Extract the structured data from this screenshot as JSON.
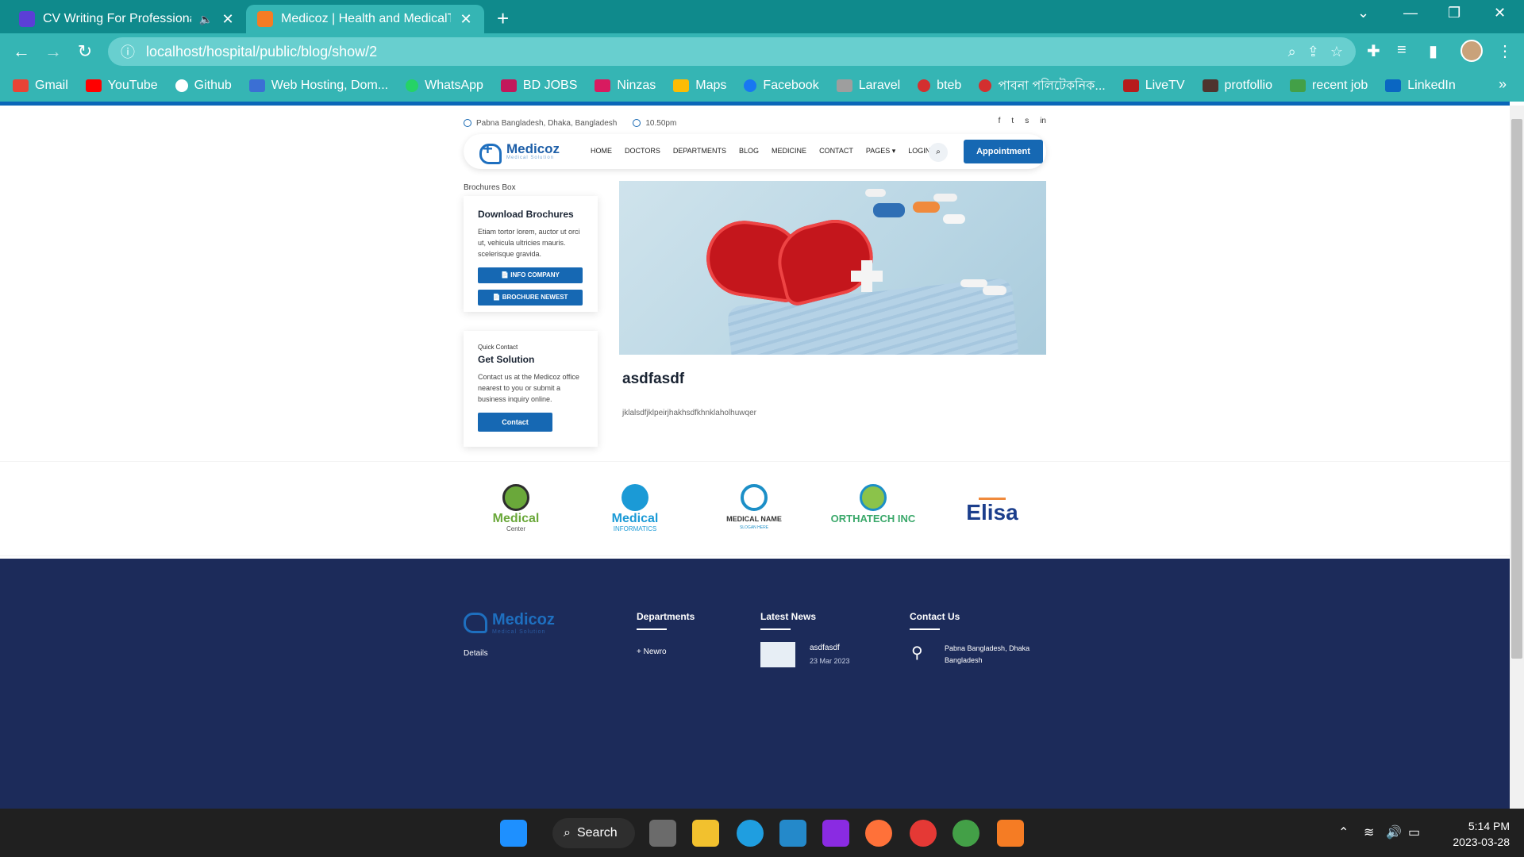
{
  "browser": {
    "tabs": [
      {
        "title": "CV Writing For Professionals",
        "active": false
      },
      {
        "title": "Medicoz | Health and MedicalTem",
        "active": true
      }
    ],
    "url": "localhost/hospital/public/blog/show/2",
    "bookmarks": [
      "Gmail",
      "YouTube",
      "Github",
      "Web Hosting, Dom...",
      "WhatsApp",
      "BD JOBS",
      "Ninzas",
      "Maps",
      "Facebook",
      "Laravel",
      "bteb",
      "পাবনা পলিটেকনিক...",
      "LiveTV",
      "protfollio",
      "recent job",
      "LinkedIn"
    ]
  },
  "site": {
    "address": "Pabna Bangladesh, Dhaka, Bangladesh",
    "time": "10.50pm",
    "logo_name": "Medicoz",
    "logo_sub": "Medical Solution",
    "menu": [
      "HOME",
      "DOCTORS",
      "DEPARTMENTS",
      "BLOG",
      "MEDICINE",
      "CONTACT",
      "PAGES ▾",
      "LOGIN"
    ],
    "appointment": "Appointment"
  },
  "sidebar": {
    "label": "Brochures Box",
    "download_title": "Download Brochures",
    "download_text": "Etiam tortor lorem, auctor ut orci ut, vehicula ultricies mauris. scelerisque gravida.",
    "btn_info": "INFO COMPANY",
    "btn_brochure": "BROCHURE NEWEST",
    "quick_label": "Quick Contact",
    "quick_title": "Get Solution",
    "quick_text": "Contact us at the Medicoz office nearest to you or submit a business inquiry online.",
    "contact_btn": "Contact"
  },
  "post": {
    "title": "asdfasdf",
    "body": "jklalsdfjklpeirjhakhsdfkhnklaholhuwqer"
  },
  "brands": [
    {
      "name": "Medical",
      "sub": "Center",
      "color": "#6aa83a"
    },
    {
      "name": "Medical",
      "sub": "INFORMATICS",
      "color": "#1b9ad6"
    },
    {
      "name": "MEDICAL NAME",
      "sub": "SLOGAN HERE",
      "color": "#1c8fc7"
    },
    {
      "name": "ORTHATECH INC",
      "sub": "",
      "color": "#3aa86a"
    },
    {
      "name": "Elisa",
      "sub": "",
      "color": "#1b3e8c"
    }
  ],
  "footer": {
    "logo_name": "Medicoz",
    "logo_sub": "Medical Solution",
    "details": "Details",
    "departments": "Departments",
    "dept_item": "Newro",
    "latest_news": "Latest News",
    "news_title": "asdfasdf",
    "news_date": "23 Mar 2023",
    "contact_us": "Contact Us",
    "contact_addr_1": "Pabna Bangladesh, Dhaka",
    "contact_addr_2": "Bangladesh"
  },
  "taskbar": {
    "search": "Search",
    "time": "5:14 PM",
    "date": "2023-03-28"
  }
}
